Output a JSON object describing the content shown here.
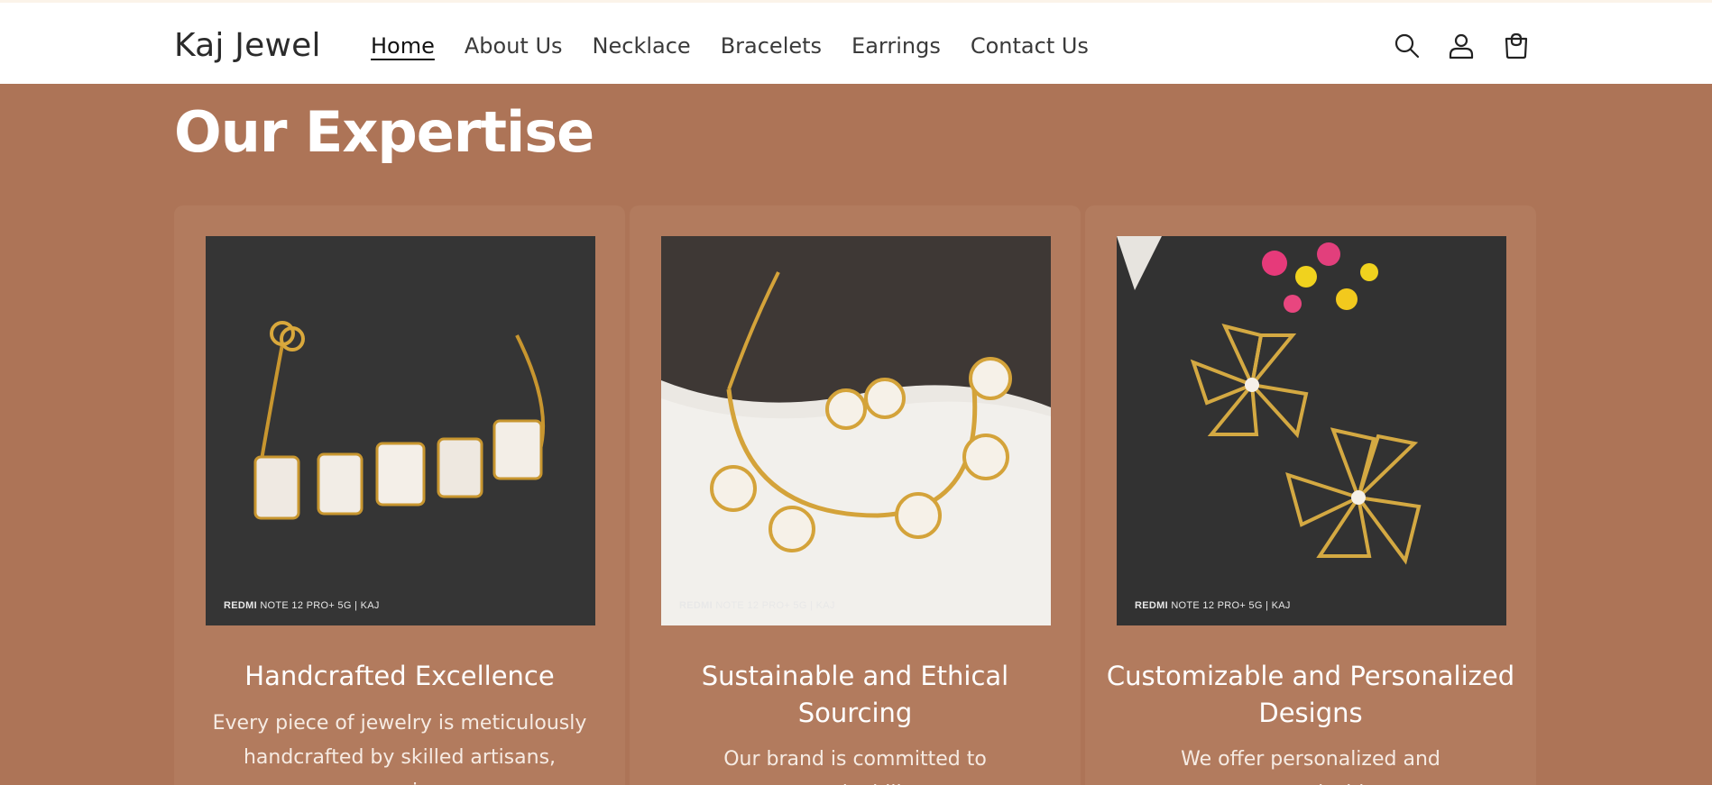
{
  "header": {
    "brand": "Kaj Jewel",
    "nav": [
      {
        "label": "Home",
        "active": true
      },
      {
        "label": "About Us"
      },
      {
        "label": "Necklace"
      },
      {
        "label": "Bracelets"
      },
      {
        "label": "Earrings"
      },
      {
        "label": "Contact Us"
      }
    ],
    "icons": [
      "search-icon",
      "account-icon",
      "cart-icon"
    ]
  },
  "section": {
    "title": "Our Expertise",
    "cards": [
      {
        "image": "pearl-bracelet-photo",
        "watermark_brand": "REDMI",
        "watermark_rest": "NOTE 12 PRO+ 5G | KAJ",
        "title": "Handcrafted Excellence",
        "text": "Every piece of jewelry is meticulously handcrafted by skilled artisans, ensuring"
      },
      {
        "image": "pearl-necklace-photo",
        "watermark_brand": "REDMI",
        "watermark_rest": "NOTE 12 PRO+ 5G | KAJ",
        "title": "Sustainable and Ethical Sourcing",
        "text": "Our brand is committed to sustainability"
      },
      {
        "image": "flower-earrings-photo",
        "watermark_brand": "REDMI",
        "watermark_rest": "NOTE 12 PRO+ 5G | KAJ",
        "title": "Customizable and Personalized Designs",
        "text": "We offer personalized and customizable"
      }
    ]
  },
  "colors": {
    "background": "#ad7457",
    "card": "#b27b5e",
    "header": "#ffffff",
    "text_dark": "#2b2b2b"
  }
}
